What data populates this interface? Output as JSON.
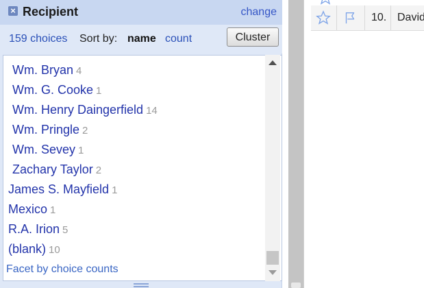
{
  "facet": {
    "title": "Recipient",
    "change_label": "change",
    "choices_label": "159 choices",
    "sort_by_label": "Sort by:",
    "sort_name_label": "name",
    "sort_count_label": "count",
    "cluster_label": "Cluster",
    "footer_link": "Facet by choice counts",
    "items": [
      {
        "name": "Wm. Bryan",
        "count": "4"
      },
      {
        "name": "Wm. G. Cooke",
        "count": "1"
      },
      {
        "name": "Wm. Henry Daingerfield",
        "count": "14"
      },
      {
        "name": "Wm. Pringle",
        "count": "2"
      },
      {
        "name": "Wm. Sevey",
        "count": "1"
      },
      {
        "name": "Zachary Taylor",
        "count": "2"
      },
      {
        "name": "James S. Mayfield",
        "count": "1"
      },
      {
        "name": "Mexico",
        "count": "1"
      },
      {
        "name": "R.A. Irion",
        "count": "5"
      },
      {
        "name": "(blank)",
        "count": "10"
      }
    ]
  },
  "grid": {
    "row_number": "10.",
    "first_cell": "David"
  },
  "icons": {
    "close": "close-icon",
    "star": "star-icon",
    "flag": "flag-icon"
  },
  "colors": {
    "header_bg": "#c8d7f1",
    "panel_bg": "#dfe8f7",
    "link": "#2a50b8",
    "item_text": "#2233aa",
    "count_text": "#9a9a9a"
  }
}
